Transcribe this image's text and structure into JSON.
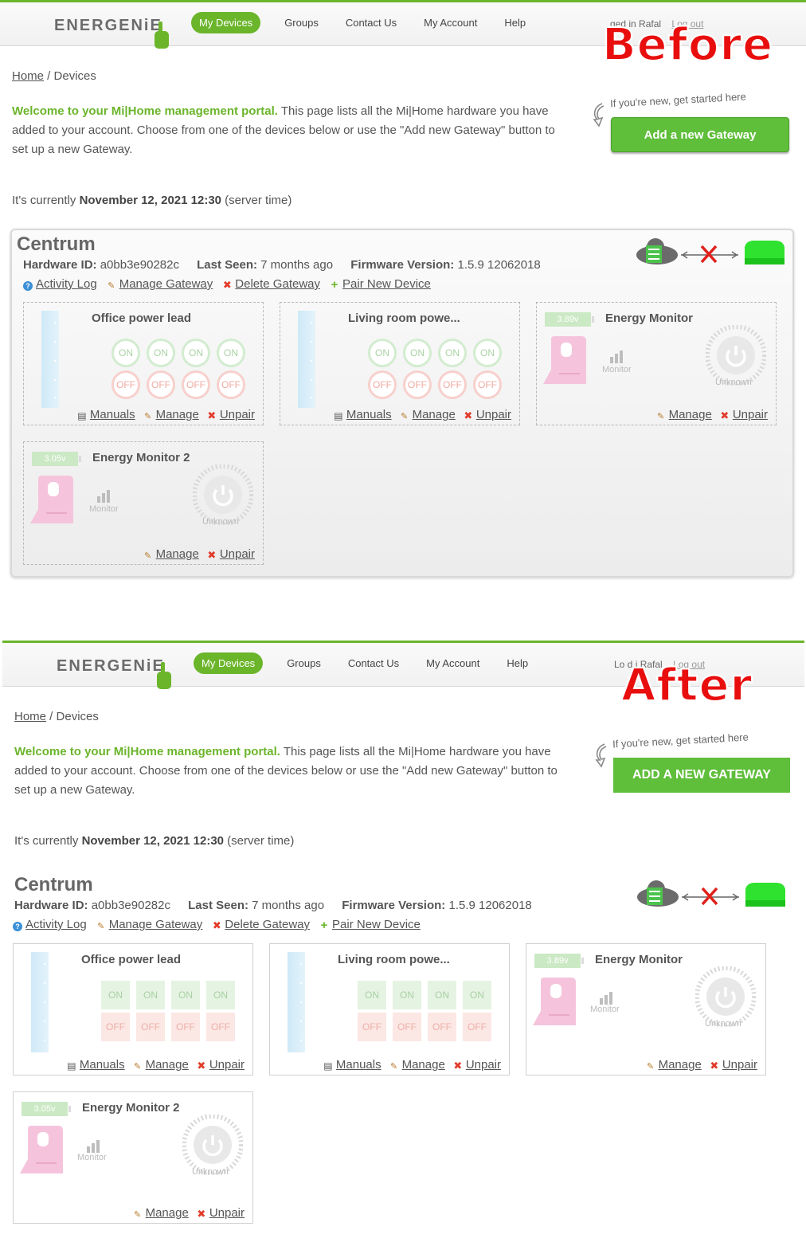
{
  "brand": "ENERGENiE",
  "nav": [
    "My Devices",
    "Groups",
    "Contact Us",
    "My Account",
    "Help"
  ],
  "user": {
    "logged_in_visible_before": "ged in  Rafal",
    "logged_in_visible_after": "Lo    d i  Rafal",
    "logout": "Log out"
  },
  "labels": {
    "before": "Before",
    "after": "After"
  },
  "breadcrumb": {
    "home": "Home",
    "current": "Devices"
  },
  "welcome": {
    "strong": "Welcome to your Mi|Home management portal.",
    "body": " This page lists all the Mi|Home hardware you have added to your account. Choose from one of the devices below or use the \"Add new Gateway\" button to set up a new Gateway."
  },
  "hint": "If you're new, get started here",
  "add_gateway": "Add a new Gateway",
  "time": {
    "prefix": "It's currently ",
    "value": "November 12, 2021 12:30",
    "suffix": " (server time)"
  },
  "gateway": {
    "name": "Centrum",
    "hardware_label": "Hardware ID:",
    "hardware_value": "a0bb3e90282c",
    "seen_label": "Last Seen:",
    "seen_value": "7 months ago",
    "firmware_label": "Firmware Version:",
    "firmware_value": "1.5.9 12062018",
    "actions": [
      "Activity Log",
      "Manage Gateway",
      "Delete Gateway",
      "Pair New Device"
    ]
  },
  "switch_labels": {
    "on": "ON",
    "off": "OFF"
  },
  "links": {
    "manuals": "Manuals",
    "manage": "Manage",
    "unpair": "Unpair"
  },
  "devices": [
    {
      "name": "Office power lead"
    },
    {
      "name": "Living room powe..."
    },
    {
      "name": "Energy Monitor",
      "battery": "3.89v",
      "monitor": "Monitor",
      "status": "Unknown"
    },
    {
      "name": "Energy Monitor 2",
      "battery": "3.05v",
      "monitor": "Monitor",
      "status": "Unknown"
    }
  ],
  "colors": {
    "brand_green": "#6bb52b",
    "button_green": "#5fbe3a",
    "delete_red": "#e23b2b",
    "label_red": "#e80e0e"
  },
  "icons": [
    "energenie-hand-icon",
    "help-icon",
    "pencil-icon",
    "delete-icon",
    "plus-icon",
    "document-icon",
    "cloud-gateway-icon",
    "disconnected-x-icon",
    "hub-device-icon",
    "power-strip-icon",
    "battery-icon",
    "energy-monitor-icon",
    "signal-bars-icon",
    "power-dial-icon",
    "hint-arrow-icon"
  ]
}
